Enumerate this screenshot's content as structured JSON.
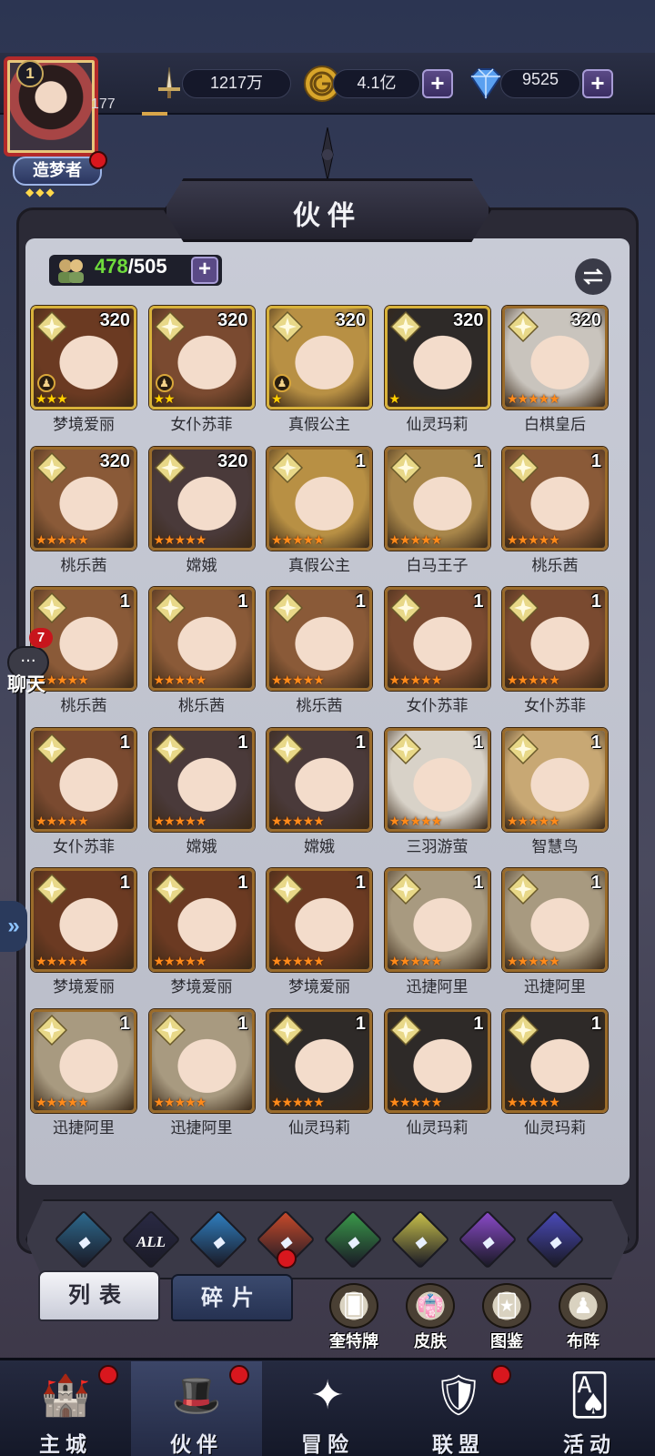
{
  "player": {
    "level": "1",
    "partial_count": "177",
    "title": "造梦者"
  },
  "resources": {
    "power": "1217万",
    "gold": "4.1亿",
    "diamonds": "9525"
  },
  "panel": {
    "title": "伙伴",
    "count_current": "478",
    "count_separator": "/",
    "count_max": "505"
  },
  "cards": [
    {
      "name": "梦境爱丽",
      "level": "320",
      "stars": "★★★",
      "star_color": "yellow",
      "badge": true,
      "face": "#6b3a22",
      "frame": "gold"
    },
    {
      "name": "女仆苏菲",
      "level": "320",
      "stars": "★★",
      "star_color": "yellow",
      "badge": true,
      "face": "#7a4a30",
      "frame": "gold"
    },
    {
      "name": "真假公主",
      "level": "320",
      "stars": "★",
      "star_color": "yellow",
      "badge": true,
      "face": "#b89044",
      "frame": "gold"
    },
    {
      "name": "仙灵玛莉",
      "level": "320",
      "stars": "★",
      "star_color": "yellow",
      "badge": false,
      "face": "#2e2a28",
      "frame": "gold"
    },
    {
      "name": "白棋皇后",
      "level": "320",
      "stars": "★★★★★",
      "star_color": "orange",
      "badge": false,
      "face": "#c9c4bd",
      "frame": "brown"
    },
    {
      "name": "桃乐茜",
      "level": "320",
      "stars": "★★★★★",
      "star_color": "orange",
      "badge": false,
      "face": "#8a5a38",
      "frame": "brown"
    },
    {
      "name": "嫦娥",
      "level": "320",
      "stars": "★★★★★",
      "star_color": "orange",
      "badge": false,
      "face": "#4a3a3a",
      "frame": "brown"
    },
    {
      "name": "真假公主",
      "level": "1",
      "stars": "★★★★★",
      "star_color": "orange",
      "badge": false,
      "face": "#b89044",
      "frame": "brown"
    },
    {
      "name": "白马王子",
      "level": "1",
      "stars": "★★★★★",
      "star_color": "orange",
      "badge": false,
      "face": "#a8864a",
      "frame": "brown"
    },
    {
      "name": "桃乐茜",
      "level": "1",
      "stars": "★★★★★",
      "star_color": "orange",
      "badge": false,
      "face": "#8a5a38",
      "frame": "brown"
    },
    {
      "name": "桃乐茜",
      "level": "1",
      "stars": "★★★★★",
      "star_color": "orange",
      "badge": false,
      "face": "#8a5a38",
      "frame": "brown"
    },
    {
      "name": "桃乐茜",
      "level": "1",
      "stars": "★★★★★",
      "star_color": "orange",
      "badge": false,
      "face": "#8a5a38",
      "frame": "brown"
    },
    {
      "name": "桃乐茜",
      "level": "1",
      "stars": "★★★★★",
      "star_color": "orange",
      "badge": false,
      "face": "#8a5a38",
      "frame": "brown"
    },
    {
      "name": "女仆苏菲",
      "level": "1",
      "stars": "★★★★★",
      "star_color": "orange",
      "badge": false,
      "face": "#7a4a30",
      "frame": "brown"
    },
    {
      "name": "女仆苏菲",
      "level": "1",
      "stars": "★★★★★",
      "star_color": "orange",
      "badge": false,
      "face": "#7a4a30",
      "frame": "brown"
    },
    {
      "name": "女仆苏菲",
      "level": "1",
      "stars": "★★★★★",
      "star_color": "orange",
      "badge": false,
      "face": "#7a4a30",
      "frame": "brown"
    },
    {
      "name": "嫦娥",
      "level": "1",
      "stars": "★★★★★",
      "star_color": "orange",
      "badge": false,
      "face": "#4a3a3a",
      "frame": "brown"
    },
    {
      "name": "嫦娥",
      "level": "1",
      "stars": "★★★★★",
      "star_color": "orange",
      "badge": false,
      "face": "#4a3a3a",
      "frame": "brown"
    },
    {
      "name": "三羽游萤",
      "level": "1",
      "stars": "★★★★★",
      "star_color": "orange",
      "badge": false,
      "face": "#d8d2c8",
      "frame": "brown"
    },
    {
      "name": "智慧鸟",
      "level": "1",
      "stars": "★★★★★",
      "star_color": "orange",
      "badge": false,
      "face": "#c8a874",
      "frame": "brown"
    },
    {
      "name": "梦境爱丽",
      "level": "1",
      "stars": "★★★★★",
      "star_color": "orange",
      "badge": false,
      "face": "#6b3a22",
      "frame": "brown"
    },
    {
      "name": "梦境爱丽",
      "level": "1",
      "stars": "★★★★★",
      "star_color": "orange",
      "badge": false,
      "face": "#6b3a22",
      "frame": "brown"
    },
    {
      "name": "梦境爱丽",
      "level": "1",
      "stars": "★★★★★",
      "star_color": "orange",
      "badge": false,
      "face": "#6b3a22",
      "frame": "brown"
    },
    {
      "name": "迅捷阿里",
      "level": "1",
      "stars": "★★★★★",
      "star_color": "orange",
      "badge": false,
      "face": "#a89a80",
      "frame": "brown"
    },
    {
      "name": "迅捷阿里",
      "level": "1",
      "stars": "★★★★★",
      "star_color": "orange",
      "badge": false,
      "face": "#a89a80",
      "frame": "brown"
    },
    {
      "name": "迅捷阿里",
      "level": "1",
      "stars": "★★★★★",
      "star_color": "orange",
      "badge": false,
      "face": "#a89a80",
      "frame": "brown"
    },
    {
      "name": "迅捷阿里",
      "level": "1",
      "stars": "★★★★★",
      "star_color": "orange",
      "badge": false,
      "face": "#a89a80",
      "frame": "brown"
    },
    {
      "name": "仙灵玛莉",
      "level": "1",
      "stars": "★★★★★",
      "star_color": "orange",
      "badge": false,
      "face": "#2e2a28",
      "frame": "brown"
    },
    {
      "name": "仙灵玛莉",
      "level": "1",
      "stars": "★★★★★",
      "star_color": "orange",
      "badge": false,
      "face": "#2e2a28",
      "frame": "brown"
    },
    {
      "name": "仙灵玛莉",
      "level": "1",
      "stars": "★★★★★",
      "star_color": "orange",
      "badge": false,
      "face": "#2e2a28",
      "frame": "brown"
    }
  ],
  "chat": {
    "label": "聊天",
    "unread": "7"
  },
  "filters": [
    {
      "name": "filter-shield-icon",
      "label": "",
      "color": "#2d6a8e"
    },
    {
      "name": "filter-all-icon",
      "label": "ALL",
      "color": "#2a2a44"
    },
    {
      "name": "filter-water-icon",
      "label": "",
      "color": "#2f7fc0"
    },
    {
      "name": "filter-fire-icon",
      "label": "",
      "color": "#c84a2a"
    },
    {
      "name": "filter-wind-icon",
      "label": "",
      "color": "#3a9a4a"
    },
    {
      "name": "filter-light-icon",
      "label": "",
      "color": "#c8c04a"
    },
    {
      "name": "filter-moon-icon",
      "label": "",
      "color": "#8a4ac8"
    },
    {
      "name": "filter-void-icon",
      "label": "",
      "color": "#4a4ab8"
    }
  ],
  "subtabs": {
    "list": "列表",
    "shards": "碎片"
  },
  "sub_buttons": [
    {
      "name": "tarot-button",
      "label": "奎特牌",
      "glyph": "🂠"
    },
    {
      "name": "skin-button",
      "label": "皮肤",
      "glyph": "👘"
    },
    {
      "name": "codex-button",
      "label": "图鉴",
      "glyph": "🃏"
    },
    {
      "name": "formation-button",
      "label": "布阵",
      "glyph": "♟"
    }
  ],
  "nav": [
    {
      "name": "nav-main-city",
      "label": "主城",
      "glyph": "🏰",
      "dot": true,
      "active": false
    },
    {
      "name": "nav-partners",
      "label": "伙伴",
      "glyph": "🎩",
      "dot": true,
      "active": true
    },
    {
      "name": "nav-adventure",
      "label": "冒险",
      "glyph": "✦",
      "dot": false,
      "active": false
    },
    {
      "name": "nav-alliance",
      "label": "联盟",
      "glyph": "🛡",
      "dot": true,
      "active": false
    },
    {
      "name": "nav-events",
      "label": "活动",
      "glyph": "🂡",
      "dot": false,
      "active": false
    }
  ]
}
